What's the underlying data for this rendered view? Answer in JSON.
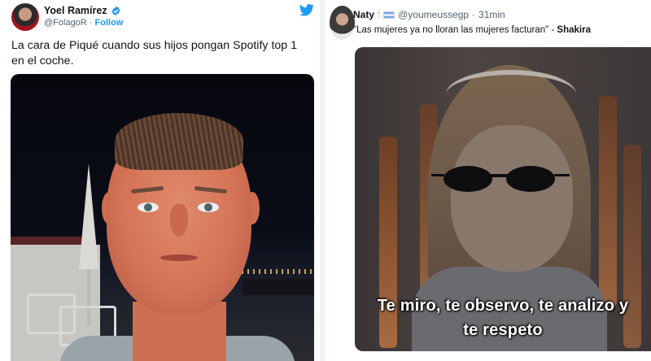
{
  "left_tweet": {
    "author_name": "Yoel Ramírez",
    "handle": "@FolagoR",
    "separator": "·",
    "follow_label": "Follow",
    "text": "La cara de Piqué cuando sus hijos pongan Spotify top 1 en el coche.",
    "icons": {
      "verified": "verified-badge-icon",
      "platform": "twitter-bird-icon"
    }
  },
  "right_tweet": {
    "author_name": "Naty",
    "handle": "@youmeussegp",
    "separator": "·",
    "time_ago": "31min",
    "quote_text": "\"Las mujeres ya no lloran las mujeres facturan\" - ",
    "quote_author": "Shakira",
    "meme_caption_line1": "Te miro, te observo, te analizo y",
    "meme_caption_line2": "te respeto",
    "icons": {
      "emoji1": "torch-emoji",
      "emoji2": "argentina-flag-emoji"
    }
  },
  "colors": {
    "link_blue": "#1d9bf0",
    "secondary_text": "#536471",
    "divider": "#eff3f4"
  }
}
